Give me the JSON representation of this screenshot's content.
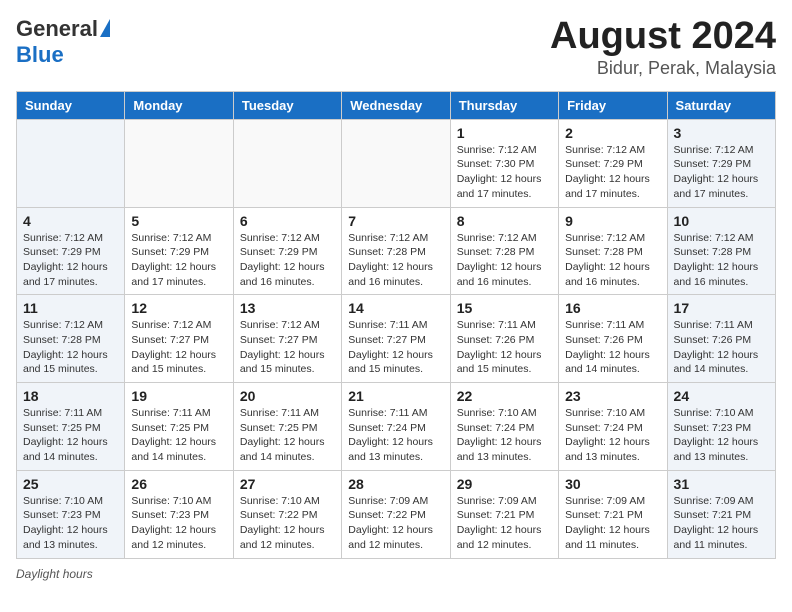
{
  "header": {
    "logo_general": "General",
    "logo_blue": "Blue",
    "month_year": "August 2024",
    "location": "Bidur, Perak, Malaysia"
  },
  "days_of_week": [
    "Sunday",
    "Monday",
    "Tuesday",
    "Wednesday",
    "Thursday",
    "Friday",
    "Saturday"
  ],
  "footer": {
    "daylight_label": "Daylight hours"
  },
  "weeks": [
    {
      "days": [
        {
          "num": "",
          "info": ""
        },
        {
          "num": "",
          "info": ""
        },
        {
          "num": "",
          "info": ""
        },
        {
          "num": "",
          "info": ""
        },
        {
          "num": "1",
          "info": "Sunrise: 7:12 AM\nSunset: 7:30 PM\nDaylight: 12 hours\nand 17 minutes."
        },
        {
          "num": "2",
          "info": "Sunrise: 7:12 AM\nSunset: 7:29 PM\nDaylight: 12 hours\nand 17 minutes."
        },
        {
          "num": "3",
          "info": "Sunrise: 7:12 AM\nSunset: 7:29 PM\nDaylight: 12 hours\nand 17 minutes."
        }
      ]
    },
    {
      "days": [
        {
          "num": "4",
          "info": "Sunrise: 7:12 AM\nSunset: 7:29 PM\nDaylight: 12 hours\nand 17 minutes."
        },
        {
          "num": "5",
          "info": "Sunrise: 7:12 AM\nSunset: 7:29 PM\nDaylight: 12 hours\nand 17 minutes."
        },
        {
          "num": "6",
          "info": "Sunrise: 7:12 AM\nSunset: 7:29 PM\nDaylight: 12 hours\nand 16 minutes."
        },
        {
          "num": "7",
          "info": "Sunrise: 7:12 AM\nSunset: 7:28 PM\nDaylight: 12 hours\nand 16 minutes."
        },
        {
          "num": "8",
          "info": "Sunrise: 7:12 AM\nSunset: 7:28 PM\nDaylight: 12 hours\nand 16 minutes."
        },
        {
          "num": "9",
          "info": "Sunrise: 7:12 AM\nSunset: 7:28 PM\nDaylight: 12 hours\nand 16 minutes."
        },
        {
          "num": "10",
          "info": "Sunrise: 7:12 AM\nSunset: 7:28 PM\nDaylight: 12 hours\nand 16 minutes."
        }
      ]
    },
    {
      "days": [
        {
          "num": "11",
          "info": "Sunrise: 7:12 AM\nSunset: 7:28 PM\nDaylight: 12 hours\nand 15 minutes."
        },
        {
          "num": "12",
          "info": "Sunrise: 7:12 AM\nSunset: 7:27 PM\nDaylight: 12 hours\nand 15 minutes."
        },
        {
          "num": "13",
          "info": "Sunrise: 7:12 AM\nSunset: 7:27 PM\nDaylight: 12 hours\nand 15 minutes."
        },
        {
          "num": "14",
          "info": "Sunrise: 7:11 AM\nSunset: 7:27 PM\nDaylight: 12 hours\nand 15 minutes."
        },
        {
          "num": "15",
          "info": "Sunrise: 7:11 AM\nSunset: 7:26 PM\nDaylight: 12 hours\nand 15 minutes."
        },
        {
          "num": "16",
          "info": "Sunrise: 7:11 AM\nSunset: 7:26 PM\nDaylight: 12 hours\nand 14 minutes."
        },
        {
          "num": "17",
          "info": "Sunrise: 7:11 AM\nSunset: 7:26 PM\nDaylight: 12 hours\nand 14 minutes."
        }
      ]
    },
    {
      "days": [
        {
          "num": "18",
          "info": "Sunrise: 7:11 AM\nSunset: 7:25 PM\nDaylight: 12 hours\nand 14 minutes."
        },
        {
          "num": "19",
          "info": "Sunrise: 7:11 AM\nSunset: 7:25 PM\nDaylight: 12 hours\nand 14 minutes."
        },
        {
          "num": "20",
          "info": "Sunrise: 7:11 AM\nSunset: 7:25 PM\nDaylight: 12 hours\nand 14 minutes."
        },
        {
          "num": "21",
          "info": "Sunrise: 7:11 AM\nSunset: 7:24 PM\nDaylight: 12 hours\nand 13 minutes."
        },
        {
          "num": "22",
          "info": "Sunrise: 7:10 AM\nSunset: 7:24 PM\nDaylight: 12 hours\nand 13 minutes."
        },
        {
          "num": "23",
          "info": "Sunrise: 7:10 AM\nSunset: 7:24 PM\nDaylight: 12 hours\nand 13 minutes."
        },
        {
          "num": "24",
          "info": "Sunrise: 7:10 AM\nSunset: 7:23 PM\nDaylight: 12 hours\nand 13 minutes."
        }
      ]
    },
    {
      "days": [
        {
          "num": "25",
          "info": "Sunrise: 7:10 AM\nSunset: 7:23 PM\nDaylight: 12 hours\nand 13 minutes."
        },
        {
          "num": "26",
          "info": "Sunrise: 7:10 AM\nSunset: 7:23 PM\nDaylight: 12 hours\nand 12 minutes."
        },
        {
          "num": "27",
          "info": "Sunrise: 7:10 AM\nSunset: 7:22 PM\nDaylight: 12 hours\nand 12 minutes."
        },
        {
          "num": "28",
          "info": "Sunrise: 7:09 AM\nSunset: 7:22 PM\nDaylight: 12 hours\nand 12 minutes."
        },
        {
          "num": "29",
          "info": "Sunrise: 7:09 AM\nSunset: 7:21 PM\nDaylight: 12 hours\nand 12 minutes."
        },
        {
          "num": "30",
          "info": "Sunrise: 7:09 AM\nSunset: 7:21 PM\nDaylight: 12 hours\nand 11 minutes."
        },
        {
          "num": "31",
          "info": "Sunrise: 7:09 AM\nSunset: 7:21 PM\nDaylight: 12 hours\nand 11 minutes."
        }
      ]
    }
  ]
}
